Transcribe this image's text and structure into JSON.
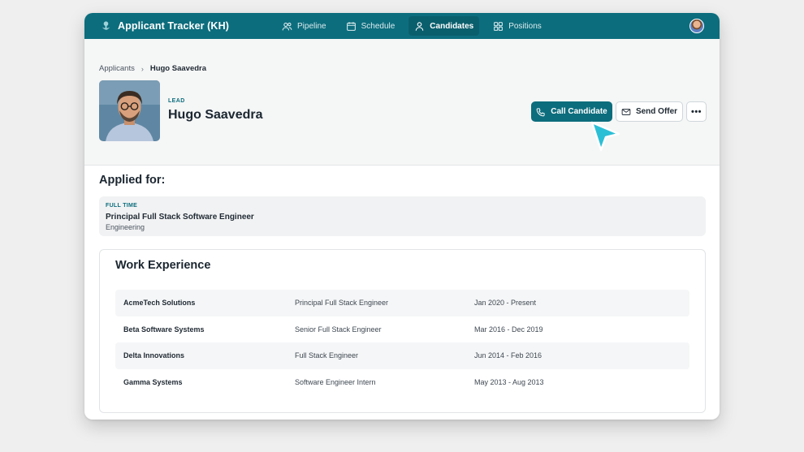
{
  "app": {
    "title": "Applicant Tracker (KH)",
    "accent_color": "#0c6d7d"
  },
  "nav": {
    "items": [
      {
        "label": "Pipeline",
        "icon": "users-icon",
        "active": false
      },
      {
        "label": "Schedule",
        "icon": "calendar-icon",
        "active": false
      },
      {
        "label": "Candidates",
        "icon": "user-icon",
        "active": true
      },
      {
        "label": "Positions",
        "icon": "grid-icon",
        "active": false
      }
    ]
  },
  "breadcrumb": {
    "parent": "Applicants",
    "current": "Hugo Saavedra"
  },
  "candidate": {
    "tag": "LEAD",
    "name": "Hugo Saavedra"
  },
  "actions": {
    "call_label": "Call Candidate",
    "offer_label": "Send Offer",
    "more_label": "•••"
  },
  "applied": {
    "heading": "Applied for:",
    "type": "FULL TIME",
    "title": "Principal Full Stack Software Engineer",
    "department": "Engineering"
  },
  "work": {
    "heading": "Work Experience",
    "rows": [
      {
        "company": "AcmeTech Solutions",
        "role": "Principal Full Stack Engineer",
        "dates": "Jan 2020 - Present"
      },
      {
        "company": "Beta Software Systems",
        "role": "Senior Full Stack Engineer",
        "dates": "Mar 2016 - Dec 2019"
      },
      {
        "company": "Delta Innovations",
        "role": "Full Stack Engineer",
        "dates": "Jun 2014 - Feb 2016"
      },
      {
        "company": "Gamma Systems",
        "role": "Software Engineer Intern",
        "dates": "May 2013 - Aug 2013"
      }
    ]
  }
}
